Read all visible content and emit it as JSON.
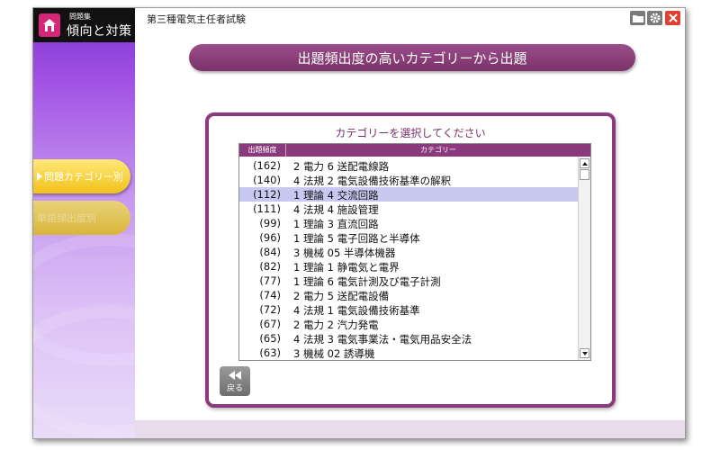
{
  "app": {
    "logo_small": "問題集",
    "logo_main": "傾向と対策",
    "title": "第三種電気主任者試験"
  },
  "sidebar": {
    "items": [
      {
        "label": "問題カテゴリー別",
        "active": true
      },
      {
        "label": "単語頻出度別",
        "active": false
      }
    ]
  },
  "toolbar": {
    "folder_icon": "folder-icon",
    "gear_icon": "gear-icon",
    "close_icon": "close-icon"
  },
  "main": {
    "banner": "出題頻出度の高いカテゴリーから出題",
    "panel_title": "カテゴリーを選択してください",
    "columns": [
      "出題頻度",
      "カテゴリー"
    ],
    "rows": [
      {
        "freq": "(162)",
        "category": "2 電力 6 送配電線路"
      },
      {
        "freq": "(140)",
        "category": "4 法規 2 電気設備技術基準の解釈"
      },
      {
        "freq": "(112)",
        "category": "1 理論 4 交流回路",
        "selected": true
      },
      {
        "freq": "(111)",
        "category": "4 法規 4 施設管理"
      },
      {
        "freq": "(99)",
        "category": "1 理論 3 直流回路"
      },
      {
        "freq": "(96)",
        "category": "1 理論 5 電子回路と半導体"
      },
      {
        "freq": "(84)",
        "category": "3 機械 05 半導体機器"
      },
      {
        "freq": "(82)",
        "category": "1 理論 1 静電気と電界"
      },
      {
        "freq": "(77)",
        "category": "1 理論 6 電気計測及び電子計測"
      },
      {
        "freq": "(74)",
        "category": "2 電力 5 送配電設備"
      },
      {
        "freq": "(72)",
        "category": "4 法規 1 電気設備技術基準"
      },
      {
        "freq": "(67)",
        "category": "2 電力 2 汽力発電"
      },
      {
        "freq": "(65)",
        "category": "4 法規 3 電気事業法・電気用品安全法"
      },
      {
        "freq": "(63)",
        "category": "3 機械 02 誘導機"
      }
    ],
    "back_label": "戻る"
  },
  "colors": {
    "accent": "#8a3a7c",
    "selected_row": "#c8c8f0",
    "nav_active": "#f1c21a",
    "close": "#e0402f"
  }
}
